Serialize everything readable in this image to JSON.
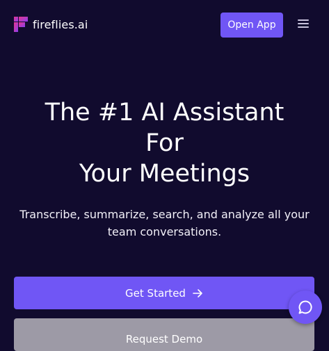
{
  "header": {
    "brand_name": "fireflies.ai",
    "logo_icon": "fireflies-logo-icon",
    "open_app_label": "Open App",
    "menu_icon": "hamburger-menu-icon"
  },
  "hero": {
    "title_lines": [
      "The #1 AI Assistant",
      "For",
      "Your Meetings"
    ],
    "subtitle_lines": [
      "Transcribe, summarize, search, and analyze all your",
      "team conversations."
    ]
  },
  "cta": {
    "get_started_label": "Get Started",
    "get_started_icon": "arrow-right-icon",
    "request_demo_label": "Request Demo"
  },
  "chat": {
    "icon": "chat-bubble-icon"
  },
  "colors": {
    "background": "#110b2e",
    "accent": "#7056f5",
    "secondary_button": "#9d9aa6",
    "logo_pink": "#e6358f",
    "logo_purple": "#8a3ff0"
  }
}
